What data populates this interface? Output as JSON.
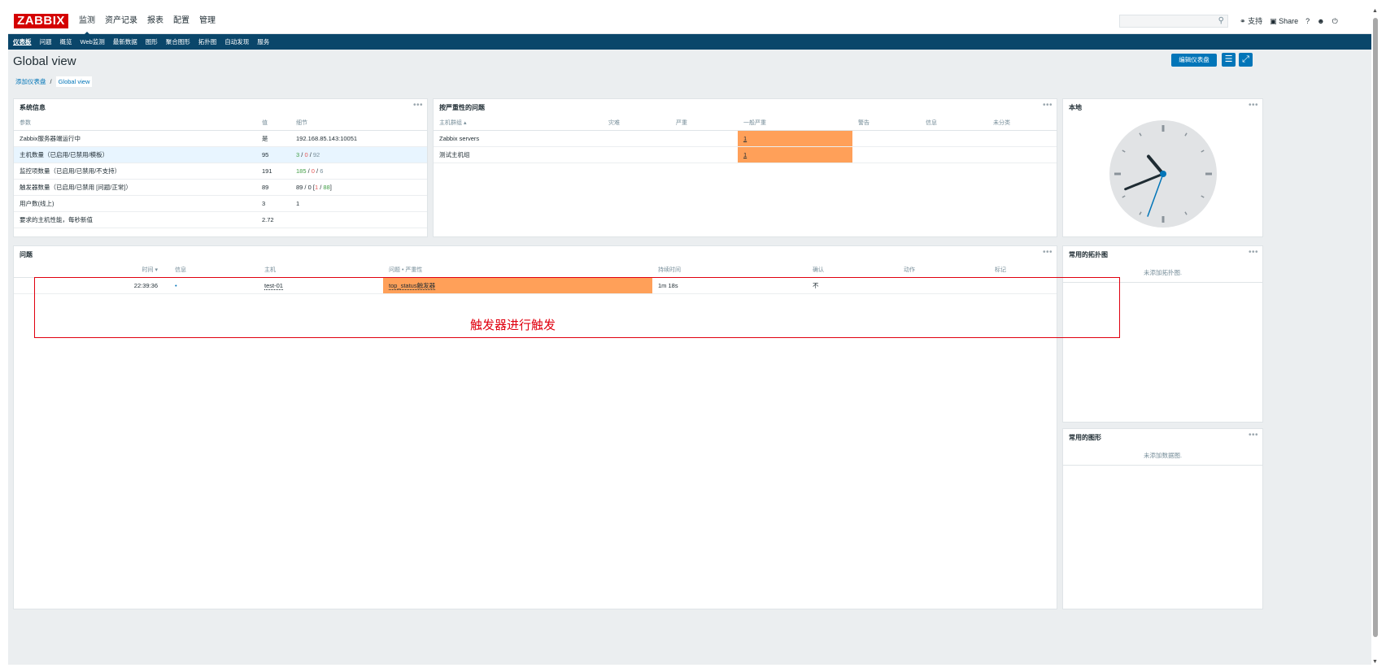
{
  "header": {
    "logo": "ZABBIX",
    "menu": [
      "监测",
      "资产记录",
      "报表",
      "配置",
      "管理"
    ],
    "support": "支持",
    "share": "Share",
    "help": "?"
  },
  "submenu": [
    "仪表板",
    "问题",
    "概览",
    "Web监测",
    "最新数据",
    "图形",
    "聚合图形",
    "拓扑图",
    "自动发现",
    "服务"
  ],
  "page": {
    "title": "Global view",
    "edit_button": "编辑仪表盘",
    "breadcrumb": [
      "添加仪表盘",
      "Global view"
    ]
  },
  "system_info": {
    "title": "系统信息",
    "headers": [
      "参数",
      "值",
      "细节"
    ],
    "rows": [
      {
        "param": "Zabbix服务器端运行中",
        "value": "是",
        "detail": "192.168.85.143:10051"
      },
      {
        "param": "主机数量（已启用/已禁用/模板）",
        "value": "95",
        "detail_a": "3",
        "detail_b": "0",
        "detail_c": "92"
      },
      {
        "param": "监控项数量（已启用/已禁用/不支持）",
        "value": "191",
        "detail_a": "185",
        "detail_b": "0",
        "detail_c": "6"
      },
      {
        "param": "触发器数量（已启用/已禁用 [问题/正常]）",
        "value": "89",
        "detail_a": "89 / 0 [",
        "detail_b": "1",
        "detail_c": "88"
      },
      {
        "param": "用户数(线上)",
        "value": "3",
        "detail": "1"
      },
      {
        "param": "要求的主机性能，每秒新值",
        "value": "2.72",
        "detail": ""
      }
    ]
  },
  "severity": {
    "title": "按严重性的问题",
    "headers": [
      "主机群组 ▴",
      "灾难",
      "严重",
      "一般严重",
      "警告",
      "信息",
      "未分类"
    ],
    "rows": [
      {
        "group": "Zabbix servers",
        "average": "1"
      },
      {
        "group": "测试主机组",
        "average": "1"
      }
    ]
  },
  "local_clock": {
    "title": "本地",
    "hour_hand_deg": -40,
    "minute_hand_deg": 248,
    "second_hand_deg": 200
  },
  "problems": {
    "title": "问题",
    "headers": [
      "时间 ▾",
      "信息",
      "主机",
      "问题 • 严重性",
      "持续时间",
      "确认",
      "动作",
      "标记"
    ],
    "rows": [
      {
        "time": "22:39:36",
        "host": "test-01",
        "problem": "top_status触发器",
        "duration": "1m 18s",
        "ack": "不"
      }
    ],
    "annotation": "触发器进行触发"
  },
  "fav_maps": {
    "title": "常用的拓扑图",
    "empty": "未添加拓扑图."
  },
  "fav_graphs": {
    "title": "常用的图形",
    "empty": "未添加数据图."
  },
  "colors": {
    "header_bar": "#0a466a",
    "logo": "#d40000",
    "average_severity": "#ffa059",
    "annotation": "#e0000f"
  }
}
